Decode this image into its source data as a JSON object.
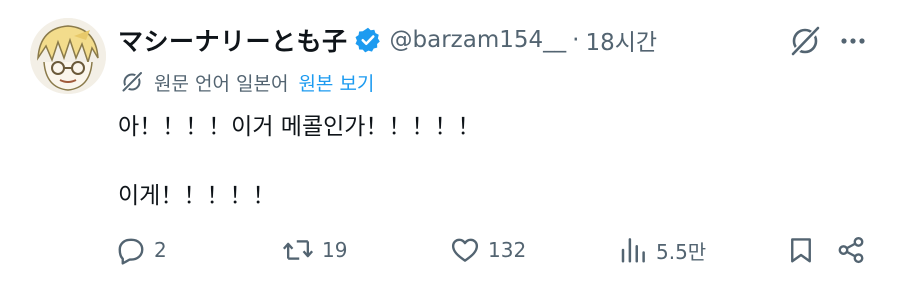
{
  "tweet": {
    "display_name": "マシーナリーとも子",
    "handle": "@barzam154__",
    "separator": "·",
    "time": "18시간",
    "translation": {
      "label": "원문 언어 일본어",
      "show_original": "원본 보기"
    },
    "body": {
      "line1": "아！！！！이거 메콜인가！！！！！",
      "line2": "이게！！！！！"
    },
    "actions": {
      "reply_count": "2",
      "retweet_count": "19",
      "like_count": "132",
      "view_count": "5.5만"
    }
  },
  "icons": {
    "verified": "verified-badge-icon",
    "grok": "grok-icon",
    "more": "more-icon",
    "translate": "translate-icon",
    "reply": "reply-icon",
    "retweet": "retweet-icon",
    "like": "heart-icon",
    "views": "views-icon",
    "bookmark": "bookmark-icon",
    "share": "share-icon"
  },
  "colors": {
    "text": "#0f1419",
    "secondary": "#536471",
    "accent": "#1d9bf0"
  }
}
